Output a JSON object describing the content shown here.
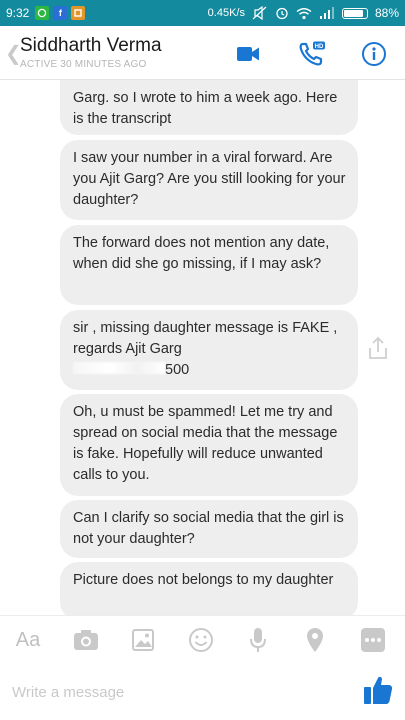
{
  "status_bar": {
    "time": "9:32",
    "network_speed": "0.45K/s",
    "battery": "88%",
    "battery_level": 0.88,
    "notification_icons": [
      "whatsapp-icon",
      "facebook-icon",
      "app-icon"
    ]
  },
  "header": {
    "contact_name": "Siddharth Verma",
    "status": "ACTIVE 30 MINUTES AGO",
    "actions": [
      "video-call-icon",
      "hd-voice-call-icon",
      "info-icon"
    ]
  },
  "messages": [
    {
      "text": "Garg. so I wrote to him a week ago. Here is the transcript"
    },
    {
      "text": "I saw your number in a viral forward. Are you Ajit Garg? Are you still looking for your daughter?"
    },
    {
      "text": "The forward does not mention any date, when did she go missing, if I may ask?"
    },
    {
      "text": "sir , missing daughter message is FAKE , regards Ajit Garg",
      "tail": "500"
    },
    {
      "text": "Oh, u must be spammed! Let me try and spread on social media that the message is fake. Hopefully will reduce unwanted calls to you."
    },
    {
      "text": "Can I clarify so social media that the girl is not your daughter?"
    },
    {
      "text": "Picture does not belongs to my daughter"
    }
  ],
  "composer": {
    "text_toggle": "Aa",
    "tools": [
      "camera-icon",
      "gallery-icon",
      "emoji-icon",
      "microphone-icon",
      "location-icon",
      "more-icon"
    ],
    "placeholder": "Write a message"
  },
  "colors": {
    "status_bar": "#148a9e",
    "accent": "#1976d2",
    "bubble": "#eeeeee"
  }
}
